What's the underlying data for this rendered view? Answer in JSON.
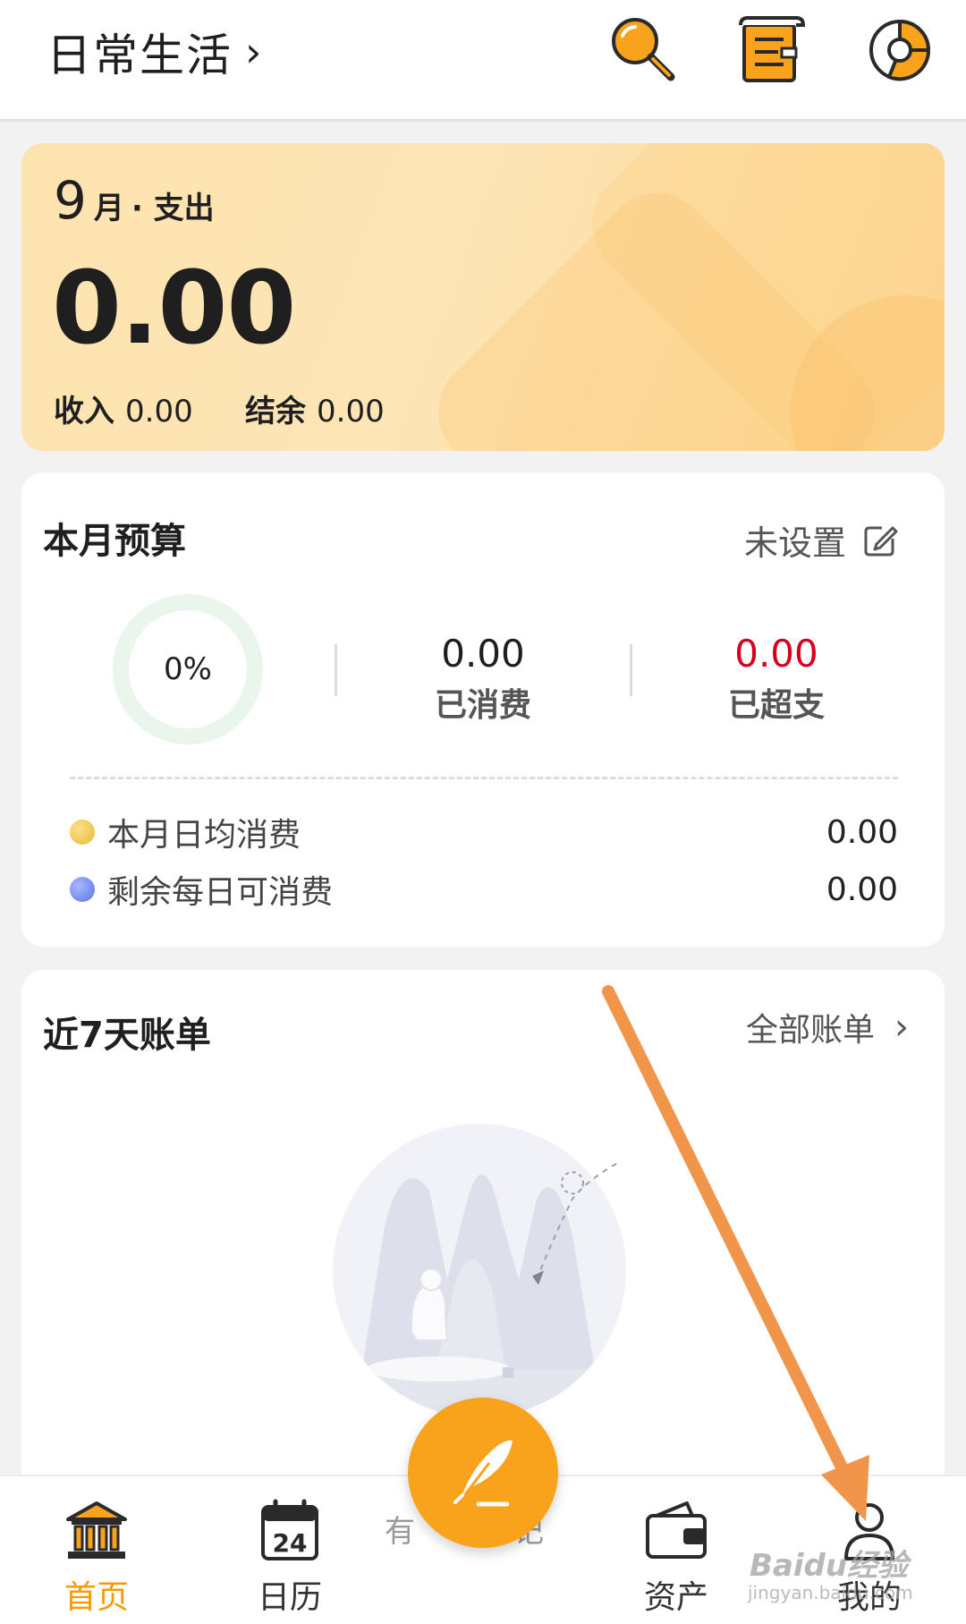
{
  "header": {
    "book_name": "日常生活",
    "chevron": "›",
    "icons": [
      "search-icon",
      "bill-list-icon",
      "pie-chart-icon"
    ]
  },
  "summary": {
    "month": "9",
    "month_unit": "月",
    "type_label": "· 支出",
    "expense": "0.00",
    "income_label": "收入",
    "income_value": "0.00",
    "balance_label": "结余",
    "balance_value": "0.00"
  },
  "budget": {
    "title": "本月预算",
    "status": "未设置",
    "percent": "0%",
    "spent_value": "0.00",
    "spent_label": "已消费",
    "over_value": "0.00",
    "over_label": "已超支",
    "over_color": "#d6001c",
    "daily_avg_label": "本月日均消费",
    "daily_avg_value": "0.00",
    "daily_remaining_label": "剩余每日可消费",
    "daily_remaining_value": "0.00"
  },
  "bills": {
    "title": "近7天账单",
    "all_link": "全部账单",
    "empty_illustration": "polar-bear-empty-state"
  },
  "nav": {
    "items": [
      {
        "label": "首页",
        "icon": "bank-icon",
        "active": true
      },
      {
        "label": "日历",
        "icon": "calendar-icon",
        "badge": "24"
      },
      {
        "label": "资产",
        "icon": "wallet-icon"
      },
      {
        "label": "我的",
        "icon": "user-icon"
      }
    ],
    "fab_icon": "feather-pen-icon",
    "fab_caption": "有记",
    "accent_color": "#f59b00"
  },
  "watermark": {
    "brand": "Baidu经验",
    "url": "jingyan.baidu.com"
  }
}
